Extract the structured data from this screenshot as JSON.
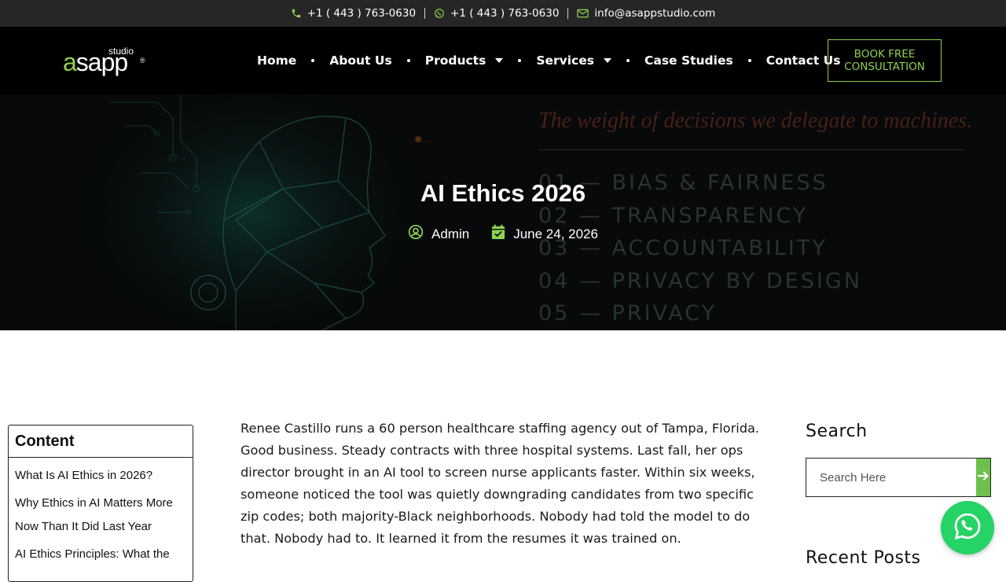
{
  "topbar": {
    "phone": "+1 ( 443 ) 763-0630",
    "whatsapp": "+1 ( 443 ) 763-0630",
    "email": "info@asappstudio.com"
  },
  "logo": {
    "studio": "studio",
    "brand_first": "a",
    "brand_rest": "sapp",
    "reg": "®"
  },
  "nav": {
    "items": [
      {
        "label": "Home"
      },
      {
        "label": "About Us"
      },
      {
        "label": "Products"
      },
      {
        "label": "Services"
      },
      {
        "label": "Case Studies"
      },
      {
        "label": "Contact Us"
      }
    ]
  },
  "cta": {
    "line1": "BOOK FREE",
    "line2": "CONSULTATION"
  },
  "hero": {
    "quote": "The weight of decisions we delegate to machines.",
    "list": [
      "01 — BIAS & FAIRNESS",
      "02 — TRANSPARENCY",
      "03 — ACCOUNTABILITY",
      "04 — PRIVACY BY DESIGN",
      "05 — PRIVACY"
    ],
    "title": "AI Ethics 2026",
    "author": "Admin",
    "date": "June 24, 2026"
  },
  "toc": {
    "title": "Content",
    "items": [
      "What Is AI Ethics in 2026?",
      "Why Ethics in AI Matters More Now Than It Did Last Year",
      "AI Ethics Principles: What the"
    ]
  },
  "article": {
    "paragraph": "Renee Castillo runs a 60 person healthcare staffing agency out of Tampa, Florida. Good business. Steady contracts with three hospital systems. Last fall, her ops director brought in an AI tool to screen nurse applicants faster. Within six weeks, someone noticed the tool was quietly downgrading candidates from two specific zip codes; both majority-Black neighborhoods. Nobody had told the model to do that. Nobody had to. It learned it from the resumes it was trained on."
  },
  "sidebar": {
    "search_title": "Search",
    "search_placeholder": "Search Here",
    "recent_title": "Recent Posts"
  },
  "colors": {
    "accent": "#8fd14f",
    "button_green": "#6cc04a",
    "whatsapp": "#25d366"
  },
  "icons": [
    "phone-icon",
    "whatsapp-icon",
    "mail-icon",
    "user-icon",
    "calendar-icon",
    "arrow-right-icon"
  ]
}
